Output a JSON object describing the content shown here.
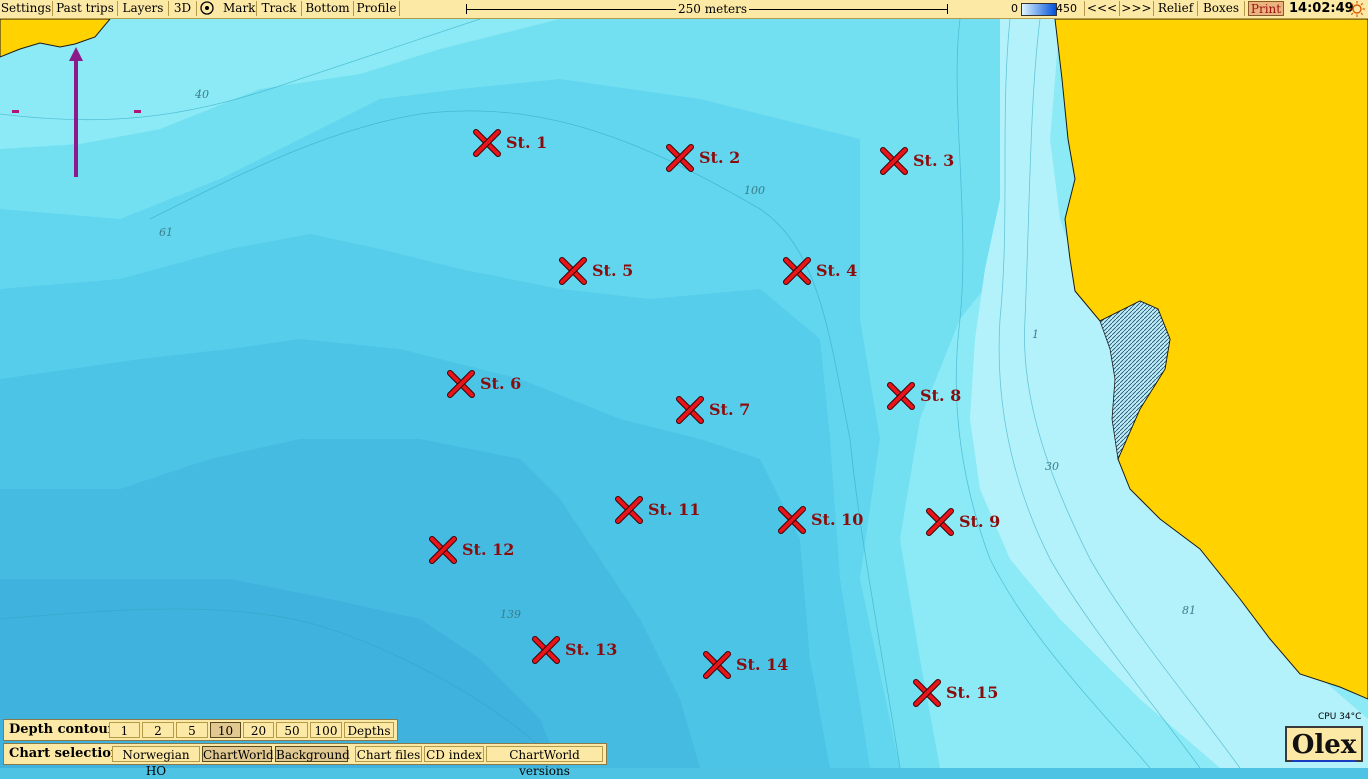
{
  "toolbar": {
    "settings": "Settings",
    "past_trips": "Past trips",
    "layers": "Layers",
    "three_d": "3D",
    "mark": "Mark",
    "track": "Track",
    "bottom": "Bottom",
    "profile": "Profile",
    "scale_label": "250 meters",
    "depth_min": "0",
    "depth_max": "450",
    "prev": "<<<",
    "next": ">>>",
    "relief": "Relief",
    "boxes": "Boxes",
    "print": "Print",
    "clock": "14:02:49"
  },
  "map": {
    "stations": [
      {
        "label": "St. 1"
      },
      {
        "label": "St. 2"
      },
      {
        "label": "St. 3"
      },
      {
        "label": "St. 4"
      },
      {
        "label": "St. 5"
      },
      {
        "label": "St. 6"
      },
      {
        "label": "St. 7"
      },
      {
        "label": "St. 8"
      },
      {
        "label": "St. 9"
      },
      {
        "label": "St. 10"
      },
      {
        "label": "St. 11"
      },
      {
        "label": "St. 12"
      },
      {
        "label": "St. 13"
      },
      {
        "label": "St. 14"
      },
      {
        "label": "St. 15"
      }
    ],
    "depth_numbers": [
      "40",
      "61",
      "100",
      "1",
      "30",
      "81",
      "139"
    ],
    "colors": {
      "land": "#ffd200",
      "station_marker": "#e8141c",
      "station_label": "#8a0d0d",
      "north_arrow": "#8b1a8b"
    }
  },
  "depth_contours": {
    "title": "Depth contours",
    "buttons": [
      "1",
      "2",
      "5",
      "10",
      "20",
      "50",
      "100"
    ],
    "active": "10",
    "depths_button": "Depths"
  },
  "chart_selection": {
    "title": "Chart selection",
    "buttons": [
      "Norwegian HO",
      "ChartWorld",
      "Background"
    ],
    "active": [
      "ChartWorld",
      "Background"
    ],
    "chart_files": "Chart files",
    "cd_index": "CD index",
    "chartworld_versions": "ChartWorld versions"
  },
  "status": {
    "cpu": "CPU 34°C",
    "brand": "Olex"
  }
}
